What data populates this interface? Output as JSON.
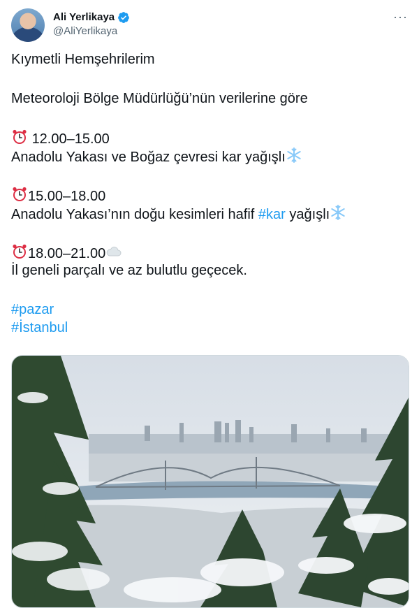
{
  "author": {
    "display_name": "Ali Yerlikaya",
    "handle": "@AliYerlikaya"
  },
  "more_label": "···",
  "tweet": {
    "line1": "Kıymetli Hemşehrilerim",
    "line2": "Meteoroloji Bölge Müdürlüğü’nün verilerine göre",
    "slot1_time": "12.00–15.00",
    "slot1_desc": "Anadolu Yakası ve Boğaz çevresi kar yağışlı",
    "slot2_time": "15.00–18.00",
    "slot2_desc_pre": "Anadolu Yakası’nın doğu kesimleri hafif ",
    "slot2_hashtag": "#kar",
    "slot2_desc_post": " yağışlı",
    "slot3_time": "18.00–21.00",
    "slot3_desc": "İl geneli parçalı ve az bulutlu geçecek.",
    "hashtag1": "#pazar",
    "hashtag2": "#İstanbul"
  },
  "icons": {
    "clock": "alarm-clock-icon",
    "snowflake": "snowflake-icon",
    "cloud": "cloud-icon",
    "verified": "verified-badge-icon"
  },
  "colors": {
    "link": "#1d9bf0",
    "text": "#0f1419",
    "secondary": "#536471"
  }
}
